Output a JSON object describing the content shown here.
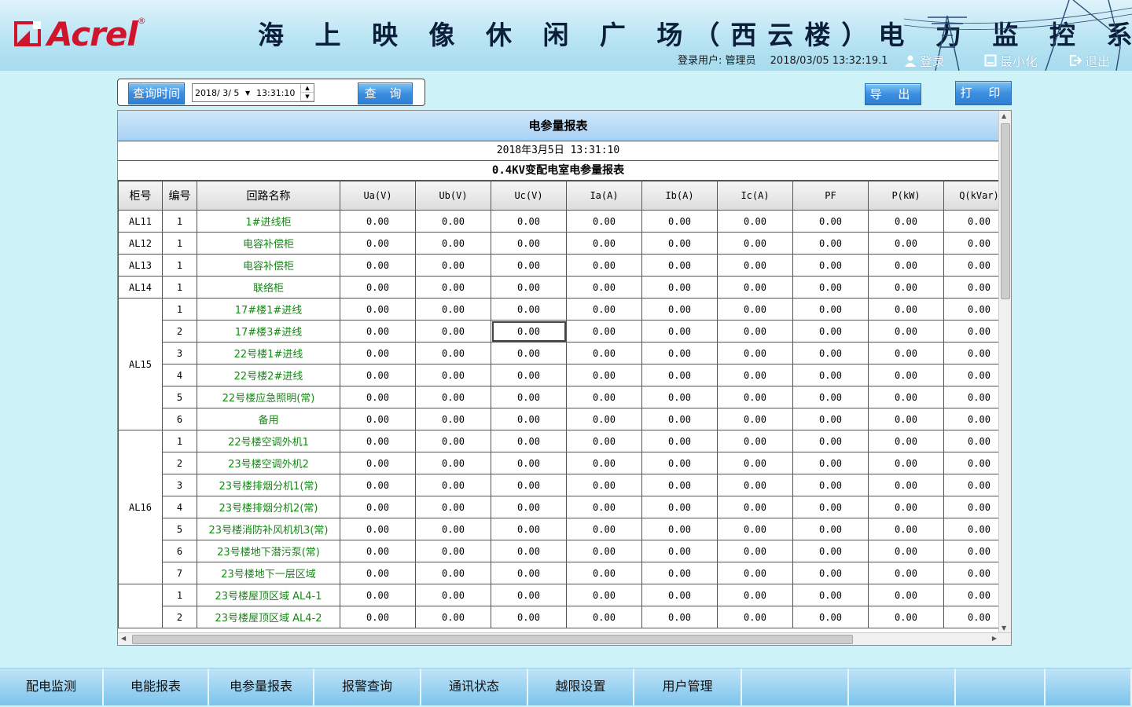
{
  "header": {
    "logo_text": "Acrel",
    "logo_reg": "®",
    "title": "海 上 映 像 休 闲 广 场（西云楼）电 力 监 控 系 统",
    "login_user_label": "登录用户: 管理员",
    "datetime": "2018/03/05 13:32:19.1",
    "login_btn": "登录",
    "minimize_btn": "最小化",
    "exit_btn": "退出"
  },
  "query": {
    "label_btn": "查询时间",
    "date": "2018/ 3/ 5",
    "time": "13:31:10",
    "search_btn": "查 询",
    "export_btn": "导 出",
    "print_btn": "打 印"
  },
  "report": {
    "title": "电参量报表",
    "date": "2018年3月5日 13:31:10",
    "subtitle": "0.4KV变配电室电参量报表",
    "columns": [
      "柜号",
      "编号",
      "回路名称",
      "Ua(V)",
      "Ub(V)",
      "Uc(V)",
      "Ia(A)",
      "Ib(A)",
      "Ic(A)",
      "PF",
      "P(kW)",
      "Q(kVar)"
    ],
    "rows": [
      {
        "cabinet": "AL11",
        "index": "1",
        "name": "1#进线柜",
        "values": [
          "0.00",
          "0.00",
          "0.00",
          "0.00",
          "0.00",
          "0.00",
          "0.00",
          "0.00",
          "0.00"
        ]
      },
      {
        "cabinet": "AL12",
        "index": "1",
        "name": "电容补偿柜",
        "values": [
          "0.00",
          "0.00",
          "0.00",
          "0.00",
          "0.00",
          "0.00",
          "0.00",
          "0.00",
          "0.00"
        ]
      },
      {
        "cabinet": "AL13",
        "index": "1",
        "name": "电容补偿柜",
        "values": [
          "0.00",
          "0.00",
          "0.00",
          "0.00",
          "0.00",
          "0.00",
          "0.00",
          "0.00",
          "0.00"
        ]
      },
      {
        "cabinet": "AL14",
        "index": "1",
        "name": "联络柜",
        "values": [
          "0.00",
          "0.00",
          "0.00",
          "0.00",
          "0.00",
          "0.00",
          "0.00",
          "0.00",
          "0.00"
        ]
      },
      {
        "cabinet": "AL15",
        "index": "1",
        "name": "17#楼1#进线",
        "values": [
          "0.00",
          "0.00",
          "0.00",
          "0.00",
          "0.00",
          "0.00",
          "0.00",
          "0.00",
          "0.00"
        ]
      },
      {
        "cabinet": "AL15",
        "index": "2",
        "name": "17#楼3#进线",
        "values": [
          "0.00",
          "0.00",
          "0.00",
          "0.00",
          "0.00",
          "0.00",
          "0.00",
          "0.00",
          "0.00"
        ]
      },
      {
        "cabinet": "AL15",
        "index": "3",
        "name": "22号楼1#进线",
        "values": [
          "0.00",
          "0.00",
          "0.00",
          "0.00",
          "0.00",
          "0.00",
          "0.00",
          "0.00",
          "0.00"
        ]
      },
      {
        "cabinet": "AL15",
        "index": "4",
        "name": "22号楼2#进线",
        "values": [
          "0.00",
          "0.00",
          "0.00",
          "0.00",
          "0.00",
          "0.00",
          "0.00",
          "0.00",
          "0.00"
        ]
      },
      {
        "cabinet": "AL15",
        "index": "5",
        "name": "22号楼应急照明(常)",
        "values": [
          "0.00",
          "0.00",
          "0.00",
          "0.00",
          "0.00",
          "0.00",
          "0.00",
          "0.00",
          "0.00"
        ]
      },
      {
        "cabinet": "AL15",
        "index": "6",
        "name": "备用",
        "values": [
          "0.00",
          "0.00",
          "0.00",
          "0.00",
          "0.00",
          "0.00",
          "0.00",
          "0.00",
          "0.00"
        ]
      },
      {
        "cabinet": "AL16",
        "index": "1",
        "name": "22号楼空调外机1",
        "values": [
          "0.00",
          "0.00",
          "0.00",
          "0.00",
          "0.00",
          "0.00",
          "0.00",
          "0.00",
          "0.00"
        ]
      },
      {
        "cabinet": "AL16",
        "index": "2",
        "name": "23号楼空调外机2",
        "values": [
          "0.00",
          "0.00",
          "0.00",
          "0.00",
          "0.00",
          "0.00",
          "0.00",
          "0.00",
          "0.00"
        ]
      },
      {
        "cabinet": "AL16",
        "index": "3",
        "name": "23号楼排烟分机1(常)",
        "values": [
          "0.00",
          "0.00",
          "0.00",
          "0.00",
          "0.00",
          "0.00",
          "0.00",
          "0.00",
          "0.00"
        ]
      },
      {
        "cabinet": "AL16",
        "index": "4",
        "name": "23号楼排烟分机2(常)",
        "values": [
          "0.00",
          "0.00",
          "0.00",
          "0.00",
          "0.00",
          "0.00",
          "0.00",
          "0.00",
          "0.00"
        ]
      },
      {
        "cabinet": "AL16",
        "index": "5",
        "name": "23号楼消防补风机机3(常)",
        "values": [
          "0.00",
          "0.00",
          "0.00",
          "0.00",
          "0.00",
          "0.00",
          "0.00",
          "0.00",
          "0.00"
        ]
      },
      {
        "cabinet": "AL16",
        "index": "6",
        "name": "23号楼地下潜污泵(常)",
        "values": [
          "0.00",
          "0.00",
          "0.00",
          "0.00",
          "0.00",
          "0.00",
          "0.00",
          "0.00",
          "0.00"
        ]
      },
      {
        "cabinet": "AL16",
        "index": "7",
        "name": "23号楼地下一层区域",
        "values": [
          "0.00",
          "0.00",
          "0.00",
          "0.00",
          "0.00",
          "0.00",
          "0.00",
          "0.00",
          "0.00"
        ]
      },
      {
        "cabinet": "",
        "index": "1",
        "name": "23号楼屋顶区域 AL4-1",
        "values": [
          "0.00",
          "0.00",
          "0.00",
          "0.00",
          "0.00",
          "0.00",
          "0.00",
          "0.00",
          "0.00"
        ]
      },
      {
        "cabinet": "",
        "index": "2",
        "name": "23号楼屋顶区域 AL4-2",
        "values": [
          "0.00",
          "0.00",
          "0.00",
          "0.00",
          "0.00",
          "0.00",
          "0.00",
          "0.00",
          "0.00"
        ]
      }
    ],
    "cabinet_groups": [
      {
        "label": "AL11",
        "start": 0,
        "span": 1
      },
      {
        "label": "AL12",
        "start": 1,
        "span": 1
      },
      {
        "label": "AL13",
        "start": 2,
        "span": 1
      },
      {
        "label": "AL14",
        "start": 3,
        "span": 1
      },
      {
        "label": "AL15",
        "start": 4,
        "span": 6
      },
      {
        "label": "AL16",
        "start": 10,
        "span": 7
      },
      {
        "label": "",
        "start": 17,
        "span": 2
      }
    ]
  },
  "nav": {
    "items": [
      "配电监测",
      "电能报表",
      "电参量报表",
      "报警查询",
      "通讯状态",
      "越限设置",
      "用户管理",
      "",
      "",
      "",
      ""
    ]
  },
  "colors": {
    "accent": "#3b8ee0",
    "name_text": "#148a14",
    "logo": "#d0142c"
  }
}
